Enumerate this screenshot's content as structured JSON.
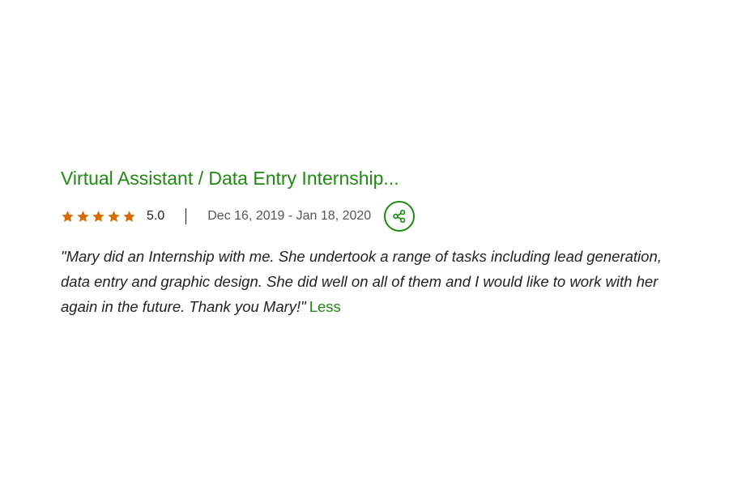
{
  "review": {
    "job_title": "Virtual Assistant / Data Entry Internship...",
    "rating": {
      "stars_filled": 5,
      "stars_total": 5,
      "value_text": "5.0",
      "star_color": "#d86c00"
    },
    "date_range": "Dec 16, 2019 - Jan 18, 2020",
    "share_icon": "share-icon",
    "feedback_text": "\"Mary did an Internship with me. She undertook a range of tasks including lead generation, data entry and graphic design. She did well on all of them and I would like to work with her again in the future. Thank you Mary!\"",
    "less_label": "Less"
  },
  "colors": {
    "accent": "#1f8a12",
    "text": "#222222",
    "muted": "#555555"
  }
}
